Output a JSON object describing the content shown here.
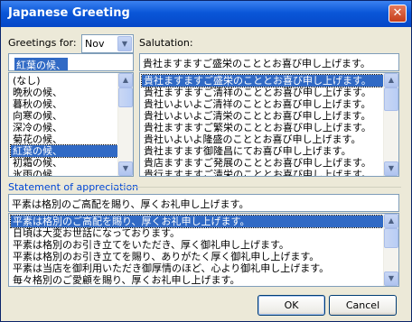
{
  "window": {
    "title": "Japanese Greeting",
    "close_glyph": "✕"
  },
  "greetings_for": {
    "label": "Greetings for:",
    "month": "Nov",
    "current": "紅葉の候、",
    "items": [
      "(なし)",
      "晩秋の候、",
      "暮秋の候、",
      "向寒の候、",
      "深冷の候、",
      "菊花の候、",
      "紅葉の候、",
      "初霜の候、",
      "氷雨の候、"
    ],
    "selected_index": 6
  },
  "salutation": {
    "label": "Salutation:",
    "current": "貴社ますますご盛栄のこととお喜び申し上げます。",
    "items": [
      "貴社ますますご盛栄のこととお喜び申し上げます。",
      "貴社ますますご清祥のこととお喜び申し上げます。",
      "貴社いよいよご清祥のこととお喜び申し上げます。",
      "貴社いよいよご清栄のこととお喜び申し上げます。",
      "貴社ますますご繁栄のこととお喜び申し上げます。",
      "貴社いよいよ隆盛のこととお喜び申し上げます。",
      "貴社ますます御隆昌にてお喜び申し上げます。",
      "貴店ますますご発展のこととお喜び申し上げます。",
      "貴行ますますご清栄のこととお喜び申し上げます。"
    ],
    "selected_index": 0
  },
  "appreciation": {
    "label": "Statement of appreciation",
    "current": "平素は格別のご高配を賜り、厚くお礼申し上げます。",
    "items": [
      "平素は格別のご高配を賜り、厚くお礼申し上げます。",
      "日頃は大変お世話になっております。",
      "平素は格別のお引き立てをいただき、厚く御礼申し上げます。",
      "平素は格別のお引き立てを賜り、ありがたく厚く御礼申し上げます。",
      "平素は当店を御利用いただき御厚情のほど、心より御礼申し上げます。",
      "毎々格別のご愛顧を賜り、厚くお礼申し上げます。"
    ],
    "selected_index": 0
  },
  "buttons": {
    "ok": "OK",
    "cancel": "Cancel"
  },
  "icons": {
    "dropdown": "chevron-down-icon",
    "scroll_up": "chevron-up-icon",
    "scroll_down": "chevron-down-icon"
  }
}
